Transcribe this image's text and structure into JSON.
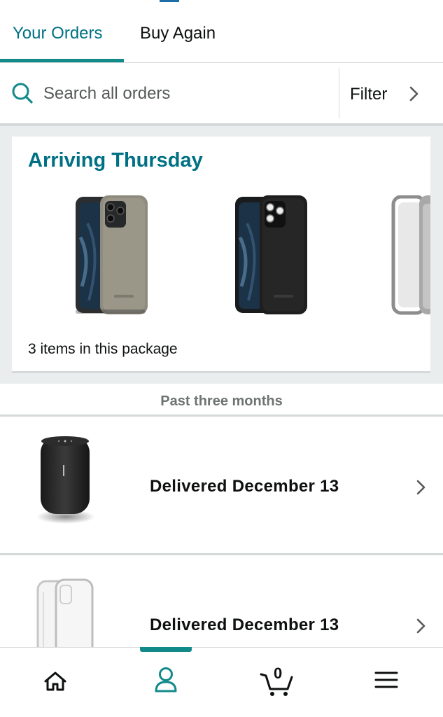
{
  "tabs": [
    {
      "label": "Your Orders",
      "active": true
    },
    {
      "label": "Buy Again",
      "active": false
    }
  ],
  "search": {
    "placeholder": "Search all orders",
    "filter_label": "Filter"
  },
  "arriving": {
    "title": "Arriving Thursday",
    "package_count": "3 items in this package",
    "items": [
      {
        "name": "phone-case-olive",
        "color": "#8f8b7e"
      },
      {
        "name": "phone-case-black",
        "color": "#1e1e1e"
      },
      {
        "name": "phone-case-clear",
        "color": "#a0a0a0"
      }
    ]
  },
  "section": {
    "title": "Past three months"
  },
  "orders": [
    {
      "status": "Delivered December 13",
      "thumb": "smart-speaker"
    },
    {
      "status": "Delivered December 13",
      "thumb": "clear-phone-case"
    }
  ],
  "bottom_nav": {
    "items": [
      "home-icon",
      "account-icon",
      "cart-icon",
      "menu-icon"
    ],
    "active": "account-icon",
    "cart_count": "0"
  },
  "colors": {
    "accent": "#007185",
    "indicator": "#138a8a",
    "text": "#0f1111",
    "muted": "#6f7373",
    "background_gray": "#eaeded",
    "divider": "#d5d9d9"
  }
}
